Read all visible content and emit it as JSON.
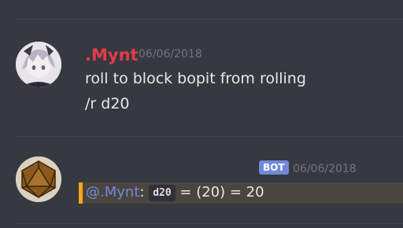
{
  "message1": {
    "username": ".Mynt",
    "timestamp": "06/06/2018",
    "lines": [
      "roll to block bopit from rolling",
      "/r d20"
    ]
  },
  "message2": {
    "badge": "BOT",
    "timestamp": "06/06/2018",
    "mention": "@.Mynt",
    "colon": ":",
    "code": "d20",
    "result": " = (20) = 20"
  },
  "colors": {
    "background": "#36393f",
    "username": "#e23c4e",
    "mention": "#7289da",
    "highlight_bar": "#faa61a",
    "bot_badge": "#7289da"
  },
  "icons": {
    "user_avatar": "anime-avatar",
    "bot_avatar": "d20-dice-avatar"
  }
}
